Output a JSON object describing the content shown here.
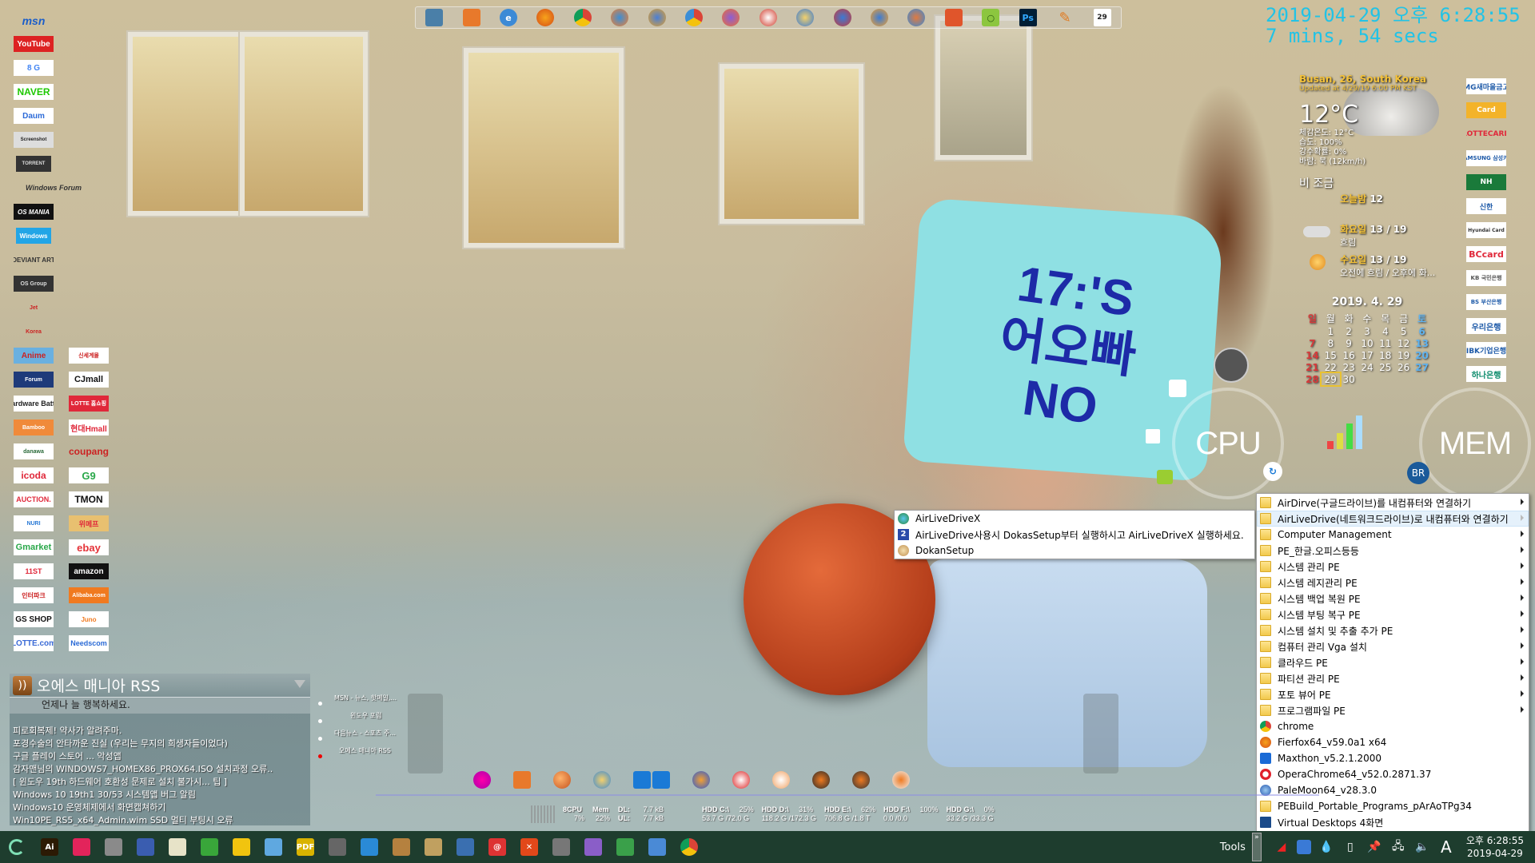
{
  "clock": {
    "datetime": "2019-04-29 오후 6:28:55",
    "uptime": "7 mins, 54 secs"
  },
  "top_dock": {
    "icons": [
      "monitor-icon",
      "firefox-folder-icon",
      "ie-icon",
      "firefox-icon",
      "chrome-icon",
      "firefox-blue-icon",
      "firefox-gold-icon",
      "chrome-alt-icon",
      "firefox-purple-icon",
      "firefox-red-icon",
      "anime-browser-icon",
      "anime-browser-2-icon",
      "waterfox-icon",
      "anime-browser-3-icon",
      "firefox-orange-icon",
      "search-green-icon",
      "photoshop-icon",
      "pencil-icon",
      "calendar-icon"
    ],
    "photoshop_label": "Ps",
    "calendar_label": "29"
  },
  "left_icons": {
    "column1": [
      "msn",
      "YouTube",
      "8 G",
      "NAVER",
      "Daum",
      "Screenshot",
      "TORRENT",
      "Windows Forum",
      "OS MANIA",
      "Windows",
      "DEVIANT ART",
      "OS Group",
      "Jet",
      "Korea"
    ],
    "column_a": [
      "Anime",
      "Forum",
      "Hardware Battle",
      "Bamboo",
      "danawa",
      "icoda",
      "AUCTION.",
      "NURI",
      "Gmarket",
      "11ST",
      "인터파크",
      "GS SHOP",
      "LOTTE.com"
    ],
    "column_b": [
      "신세계몰",
      "CJmall",
      "LOTTE 홈쇼핑",
      "현대Hmall",
      "coupang",
      "G9",
      "TMON",
      "위메프",
      "ebay",
      "amazon",
      "Alibaba.com",
      "Juno",
      "Needscom"
    ]
  },
  "bank_icons": [
    "MG새마을금고",
    "Card",
    "LOTTECARD",
    "SAMSUNG 삼성카드",
    "NH",
    "신한",
    "Hyundai Card",
    "BCcard",
    "KB 국민은행",
    "BS 부산은행",
    "우리은행",
    "IBK기업은행",
    "하나은행"
  ],
  "weather": {
    "city": "Busan, 26, South Korea",
    "updated": "Updated at 4/29/19 6:00 PM KST",
    "temp": "12°C",
    "details": [
      "체감온도: 12°C",
      "습도: 100%",
      "강수확률: 0%",
      "바람: 북 (12km/h)"
    ],
    "condition": "비 조금",
    "forecast": [
      {
        "day": "오늘밤",
        "temps": "12",
        "desc": ""
      },
      {
        "day": "화요일",
        "temps": "13 / 19",
        "desc": "흐림"
      },
      {
        "day": "수요일",
        "temps": "13 / 19",
        "desc": "오전에 흐림 / 오후에 화..."
      }
    ]
  },
  "calendar": {
    "title": "2019. 4. 29",
    "weekdays": [
      "일",
      "월",
      "화",
      "수",
      "목",
      "금",
      "토"
    ],
    "weeks": [
      [
        "",
        "1",
        "2",
        "3",
        "4",
        "5",
        "6"
      ],
      [
        "7",
        "8",
        "9",
        "10",
        "11",
        "12",
        "13"
      ],
      [
        "14",
        "15",
        "16",
        "17",
        "18",
        "19",
        "20"
      ],
      [
        "21",
        "22",
        "23",
        "24",
        "25",
        "26",
        "27"
      ],
      [
        "28",
        "29",
        "30",
        "",
        "",
        "",
        ""
      ]
    ],
    "today": "29"
  },
  "gauges": {
    "cpu_label": "CPU",
    "mem_label": "MEM"
  },
  "context_menu": {
    "items": [
      {
        "label": "AirDirve(구글드라이브)를 내컴퓨터와 연결하기",
        "icon": "folder-icon",
        "submenu": true,
        "highlighted": false
      },
      {
        "label": "AirLiveDrive(네트워크드라이브)로 내컴퓨터와 연결하기",
        "icon": "folder-icon",
        "submenu": true,
        "highlighted": true
      },
      {
        "label": "Computer Management",
        "icon": "folder-icon",
        "submenu": true,
        "highlighted": false
      },
      {
        "label": "PE_한글.오피스등등",
        "icon": "folder-icon",
        "submenu": true,
        "highlighted": false
      },
      {
        "label": "시스템 관리 PE",
        "icon": "folder-icon",
        "submenu": true,
        "highlighted": false
      },
      {
        "label": "시스템 레지관리 PE",
        "icon": "folder-icon",
        "submenu": true,
        "highlighted": false
      },
      {
        "label": "시스템 백업 복원 PE",
        "icon": "folder-icon",
        "submenu": true,
        "highlighted": false
      },
      {
        "label": "시스템 부팅 복구 PE",
        "icon": "folder-icon",
        "submenu": true,
        "highlighted": false
      },
      {
        "label": "시스템 설치 및 추출 추가 PE",
        "icon": "folder-icon",
        "submenu": true,
        "highlighted": false
      },
      {
        "label": "컴퓨터 관리 Vga 설치",
        "icon": "folder-icon",
        "submenu": true,
        "highlighted": false
      },
      {
        "label": "클라우드 PE",
        "icon": "folder-icon",
        "submenu": true,
        "highlighted": false
      },
      {
        "label": "파티션 관리 PE",
        "icon": "folder-icon",
        "submenu": true,
        "highlighted": false
      },
      {
        "label": "포토 뷰어 PE",
        "icon": "folder-icon",
        "submenu": true,
        "highlighted": false
      },
      {
        "label": "프로그램파일 PE",
        "icon": "folder-icon",
        "submenu": true,
        "highlighted": false
      },
      {
        "label": "chrome",
        "icon": "chrome-icon",
        "submenu": false,
        "highlighted": false
      },
      {
        "label": "Fierfox64_v59.0a1 x64",
        "icon": "firefox-icon",
        "submenu": false,
        "highlighted": false
      },
      {
        "label": "Maxthon_v5.2.1.2000",
        "icon": "maxthon-icon",
        "submenu": false,
        "highlighted": false
      },
      {
        "label": "OperaChrome64_v52.0.2871.37",
        "icon": "opera-icon",
        "submenu": false,
        "highlighted": false
      },
      {
        "label": "PaleMoon64_v28.3.0",
        "icon": "palemoon-icon",
        "submenu": false,
        "highlighted": false
      },
      {
        "label": "PEBuild_Portable_Programs_pArAoTPg34",
        "icon": "folder-icon",
        "submenu": false,
        "highlighted": false
      },
      {
        "label": "Virtual Desktops 4화면",
        "icon": "monitor-icon",
        "submenu": false,
        "highlighted": false
      }
    ]
  },
  "submenu": {
    "items": [
      {
        "label": "AirLiveDriveX",
        "icon": "network-globe-icon"
      },
      {
        "label": "AirLiveDrive사용시 DokasSetup부터 실행하시고 AirLiveDriveX 실행하세요.",
        "icon": "number-2-icon"
      },
      {
        "label": "DokanSetup",
        "icon": "setup-icon"
      }
    ]
  },
  "rss": {
    "title": "오에스 매니아 RSS",
    "greeting": "언제나 늘 행복하세요.",
    "items": [
      "피로회복제! 약사가 알려주마.",
      "포경수술의 안타까운 진실 (우리는 무지의 희생자들이었다)",
      "구글 플레이 스토어 ... 악성앱",
      "감자맨님의 WINDOWS7_HOMEX86_PROX64.ISO 설치과정 오류..",
      "[ 윈도우 19th 하드웨어 호환성 문제로 설치 불가시... 팁 ]",
      "Windows 10 19th1 30/53 시스템앱 버그 알림",
      "Windows10 운영체제에서 화면캡쳐하기",
      "Win10PE_RS5_x64_Admin.wim SSD 멀티 부팅시 오류"
    ]
  },
  "feed_list": {
    "items": [
      "MSN - 뉴스, 핫메일,...",
      "윈도우 포럼",
      "다음뉴스 - 스포츠 주...",
      "오에스 매니아 RSS"
    ],
    "active_index": 3
  },
  "bottom_dock": {
    "icons": [
      "media-player-icon",
      "firefox-folder-icon",
      "firefox-anime-icon",
      "browser-anime-icon",
      "teamviewer-icon",
      "teamviewer-2-icon",
      "browser-tails-icon",
      "waterfox-red-icon",
      "browser-orange-icon",
      "browser-green-icon",
      "firefox-dark-icon",
      "firefox-white-icon"
    ]
  },
  "sysmon": {
    "cpu_label": "8CPU",
    "cpu_value": "7%",
    "mem_label": "Mem",
    "mem_value": "22%",
    "dl_label": "DL:",
    "dl_value": "7.7 kB",
    "ul_label": "UL:",
    "ul_value": "7.7 kB",
    "drives": [
      {
        "label": "HDD C:\\",
        "pct": "25%",
        "usage": "53.7 G  /72.0 G"
      },
      {
        "label": "HDD D:\\",
        "pct": "31%",
        "usage": "118.2 G /172.3 G"
      },
      {
        "label": "HDD E:\\",
        "pct": "62%",
        "usage": "706.8 G /1.8 T"
      },
      {
        "label": "HDD F:\\",
        "pct": "100%",
        "usage": "0.0        /0.0"
      },
      {
        "label": "HDD G:\\",
        "pct": "0%",
        "usage": "33.2 G  /33.3 G"
      }
    ]
  },
  "taskbar": {
    "pinned": [
      {
        "name": "illustrator",
        "label": "Ai",
        "color": "#2c1a04"
      },
      {
        "name": "presentation",
        "label": "",
        "color": "#e3245b"
      },
      {
        "name": "disk-tool",
        "label": "",
        "color": "#8a8a8a"
      },
      {
        "name": "save",
        "label": "",
        "color": "#3a5db0"
      },
      {
        "name": "notepad",
        "label": "",
        "color": "#e7e3c8"
      },
      {
        "name": "clover",
        "label": "",
        "color": "#39a63a"
      },
      {
        "name": "potplayer",
        "label": "",
        "color": "#f1c40f"
      },
      {
        "name": "paint",
        "label": "",
        "color": "#5fa8e0"
      },
      {
        "name": "pdf",
        "label": "PDF",
        "color": "#d9b300"
      },
      {
        "name": "hdd-tool",
        "label": "",
        "color": "#666"
      },
      {
        "name": "triangle-app",
        "label": "",
        "color": "#2a8ad6"
      },
      {
        "name": "installer",
        "label": "",
        "color": "#b5813f"
      },
      {
        "name": "unlock",
        "label": "",
        "color": "#c0a060"
      },
      {
        "name": "monitor-chart",
        "label": "",
        "color": "#3a6fb0"
      },
      {
        "name": "email-shield",
        "label": "@",
        "color": "#d33"
      },
      {
        "name": "close-x",
        "label": "✕",
        "color": "#e2481a"
      },
      {
        "name": "ccleaner",
        "label": "",
        "color": "#777"
      },
      {
        "name": "disc",
        "label": "",
        "color": "#8a5ec8"
      },
      {
        "name": "network-drive",
        "label": "",
        "color": "#3aa04a"
      },
      {
        "name": "shield",
        "label": "",
        "color": "#4a8ad6"
      },
      {
        "name": "chrome",
        "label": "",
        "color": "#de4b39"
      }
    ],
    "tools_label": "Tools",
    "overflow_label": "»",
    "tray_icons": [
      "network-signal-icon",
      "app-tray-icon",
      "drop-icon",
      "usb-icon",
      "pin-icon",
      "network-icon",
      "volume-icon",
      "ime-icon"
    ],
    "ime_label": "A",
    "time": "오후 6:28:55",
    "date": "2019-04-29"
  }
}
